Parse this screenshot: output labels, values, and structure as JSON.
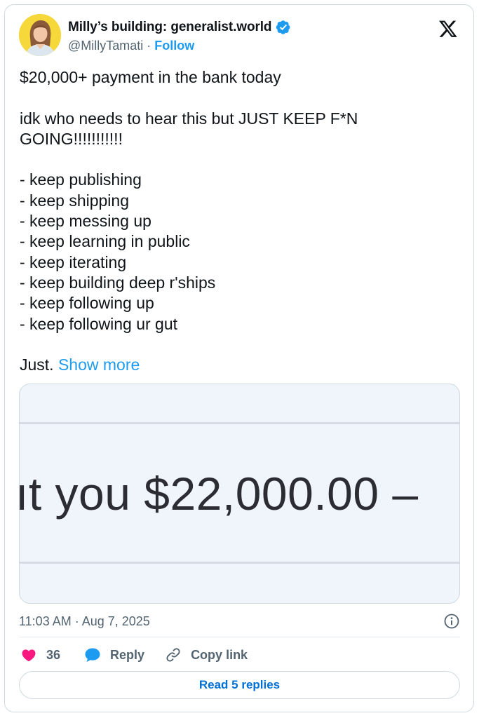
{
  "author": {
    "display_name": "Milly’s building: generalist.world",
    "handle": "@MillyTamati",
    "separator": "·",
    "follow_label": "Follow"
  },
  "tweet": {
    "text": "$20,000+ payment in the bank today\n\nidk who needs to hear this but JUST KEEP F*N GOING!!!!!!!!!!!\n\n- keep publishing\n- keep shipping\n- keep messing up\n- keep learning in public\n- keep iterating\n- keep building deep r'ships\n- keep following up\n- keep following ur gut\n\nJust. ",
    "show_more": "Show more"
  },
  "media": {
    "amount_text": "ıt you $22,000.00 –"
  },
  "meta": {
    "timestamp": "11:03 AM · Aug 7, 2025"
  },
  "actions": {
    "like_count": "36",
    "reply_label": "Reply",
    "copy_link_label": "Copy link"
  },
  "replies": {
    "read_label": "Read 5 replies"
  },
  "colors": {
    "accent": "#1d9bf0",
    "like": "#f91880",
    "text_secondary": "#536471",
    "border": "#cfd9de"
  },
  "icons": {
    "brand": "x-logo-icon",
    "verified": "verified-badge-icon",
    "info": "info-icon",
    "like": "heart-icon",
    "reply": "speech-bubble-icon",
    "copy": "link-icon"
  }
}
